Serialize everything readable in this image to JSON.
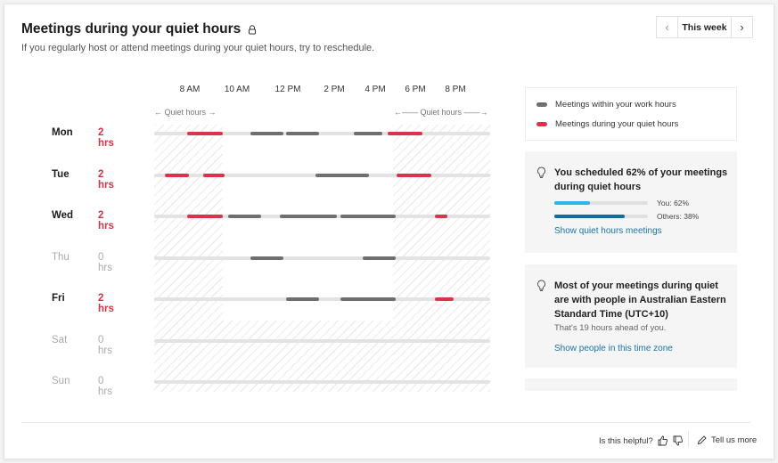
{
  "header": {
    "title": "Meetings during your quiet hours",
    "subtitle": "If you regularly host or attend meetings during your quiet hours, try to reschedule.",
    "week_label": "This week",
    "prev_icon": "chevron-left-icon",
    "next_icon": "chevron-right-icon"
  },
  "chart_data": {
    "type": "timeline",
    "x_ticks": [
      {
        "label": "8 AM",
        "hour": 8
      },
      {
        "label": "10 AM",
        "hour": 10
      },
      {
        "label": "12 PM",
        "hour": 12
      },
      {
        "label": "2 PM",
        "hour": 14
      },
      {
        "label": "4 PM",
        "hour": 16
      },
      {
        "label": "6 PM",
        "hour": 18
      },
      {
        "label": "8 PM",
        "hour": 20
      }
    ],
    "x_range_hours": [
      6.4,
      21.5
    ],
    "quiet_hours_label": "Quiet hours",
    "quiet_hours": {
      "morning_end": 9.5,
      "evening_start": 17.1,
      "weekend_quiet": true
    },
    "colors": {
      "work": "#6e6e6e",
      "quiet": "#d9344b",
      "track": "#e3e3e3"
    },
    "days": [
      {
        "day": "Mon",
        "hours_label": "2 hrs",
        "active": true,
        "quiet_highlight": true,
        "segments": [
          {
            "start": 7.9,
            "end": 9.5,
            "type": "quiet"
          },
          {
            "start": 10.7,
            "end": 12.2,
            "type": "work"
          },
          {
            "start": 12.3,
            "end": 13.8,
            "type": "work"
          },
          {
            "start": 15.3,
            "end": 16.6,
            "type": "work"
          },
          {
            "start": 16.8,
            "end": 18.4,
            "type": "quiet"
          }
        ]
      },
      {
        "day": "Tue",
        "hours_label": "2 hrs",
        "active": true,
        "quiet_highlight": true,
        "segments": [
          {
            "start": 6.9,
            "end": 8.0,
            "type": "quiet"
          },
          {
            "start": 8.6,
            "end": 9.6,
            "type": "quiet"
          },
          {
            "start": 13.6,
            "end": 16.0,
            "type": "work"
          },
          {
            "start": 17.2,
            "end": 18.8,
            "type": "quiet"
          }
        ]
      },
      {
        "day": "Wed",
        "hours_label": "2 hrs",
        "active": true,
        "quiet_highlight": true,
        "segments": [
          {
            "start": 7.9,
            "end": 9.5,
            "type": "quiet"
          },
          {
            "start": 9.7,
            "end": 11.2,
            "type": "work"
          },
          {
            "start": 12.0,
            "end": 14.6,
            "type": "work"
          },
          {
            "start": 14.7,
            "end": 17.2,
            "type": "work"
          },
          {
            "start": 18.9,
            "end": 19.5,
            "type": "quiet"
          }
        ]
      },
      {
        "day": "Thu",
        "hours_label": "0 hrs",
        "active": false,
        "quiet_highlight": false,
        "segments": [
          {
            "start": 10.7,
            "end": 12.2,
            "type": "work"
          },
          {
            "start": 15.7,
            "end": 17.2,
            "type": "work"
          }
        ]
      },
      {
        "day": "Fri",
        "hours_label": "2 hrs",
        "active": true,
        "quiet_highlight": true,
        "segments": [
          {
            "start": 12.3,
            "end": 13.8,
            "type": "work"
          },
          {
            "start": 14.7,
            "end": 17.2,
            "type": "work"
          },
          {
            "start": 18.9,
            "end": 19.8,
            "type": "quiet"
          }
        ]
      },
      {
        "day": "Sat",
        "hours_label": "0 hrs",
        "active": false,
        "quiet_highlight": false,
        "segments": []
      },
      {
        "day": "Sun",
        "hours_label": "0 hrs",
        "active": false,
        "quiet_highlight": false,
        "segments": []
      }
    ]
  },
  "legend": {
    "work": "Meetings within your work hours",
    "quiet": "Meetings during your quiet hours"
  },
  "insight1": {
    "icon": "lightbulb-icon",
    "headline": "You scheduled 62% of your meetings during quiet hours",
    "you_label": "You: 62%",
    "you_value": 0.38,
    "you_color": "#2bb8e8",
    "others_label": "Others: 38%",
    "others_value": 0.75,
    "others_color": "#0f6ea0",
    "link": "Show quiet hours meetings"
  },
  "insight2": {
    "icon": "lightbulb-icon",
    "headline": "Most of your meetings during quiet are with people in Australian Eastern Standard Time (UTC+10)",
    "body": "That's 19 hours ahead of you.",
    "link": "Show people in this time zone"
  },
  "footer": {
    "helpful": "Is this helpful?",
    "tell_more": "Tell us more"
  }
}
